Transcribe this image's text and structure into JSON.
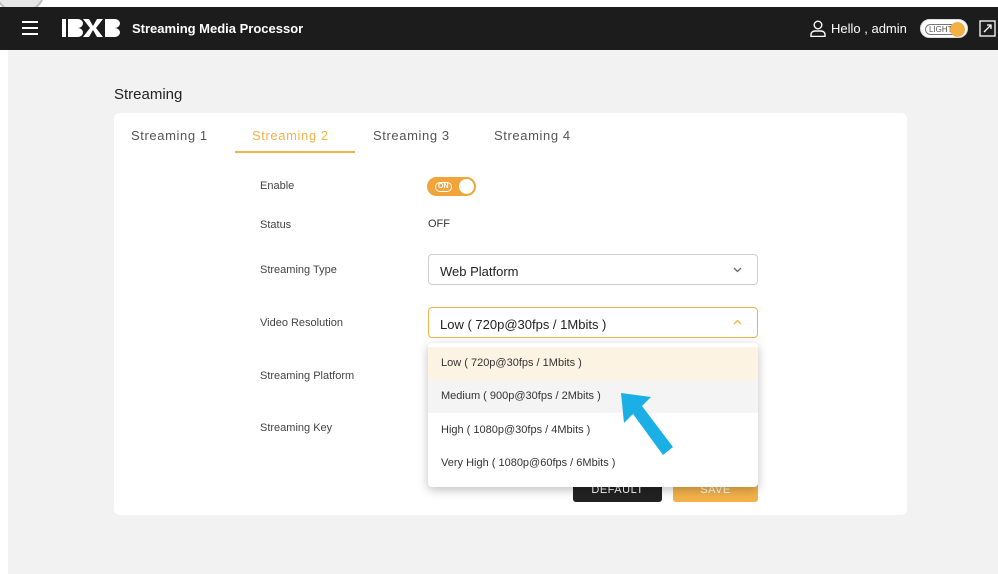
{
  "header": {
    "logo_text": "BXB",
    "app_title": "Streaming Media Processor",
    "greeting": "Hello , admin",
    "theme_label": "LIGHT"
  },
  "page": {
    "title": "Streaming"
  },
  "tabs": [
    {
      "label": "Streaming 1"
    },
    {
      "label": "Streaming 2",
      "active": true
    },
    {
      "label": "Streaming 3"
    },
    {
      "label": "Streaming 4"
    }
  ],
  "form": {
    "enable_label": "Enable",
    "enable_toggle": "ON",
    "status_label": "Status",
    "status_value": "OFF",
    "type_label": "Streaming Type",
    "type_value": "Web Platform",
    "resolution_label": "Video Resolution",
    "resolution_value": "Low ( 720p@30fps / 1Mbits )",
    "platform_label": "Streaming Platform",
    "key_label": "Streaming Key"
  },
  "resolution_options": [
    "Low ( 720p@30fps / 1Mbits )",
    "Medium ( 900p@30fps / 2Mbits )",
    "High ( 1080p@30fps / 4Mbits )",
    "Very High ( 1080p@60fps / 6Mbits )"
  ],
  "buttons": {
    "default": "DEFAULT",
    "save": "SAVE"
  },
  "colors": {
    "accent": "#f0b24a",
    "topbar": "#1c1c1c",
    "pointer_arrow": "#1ab0e6"
  }
}
